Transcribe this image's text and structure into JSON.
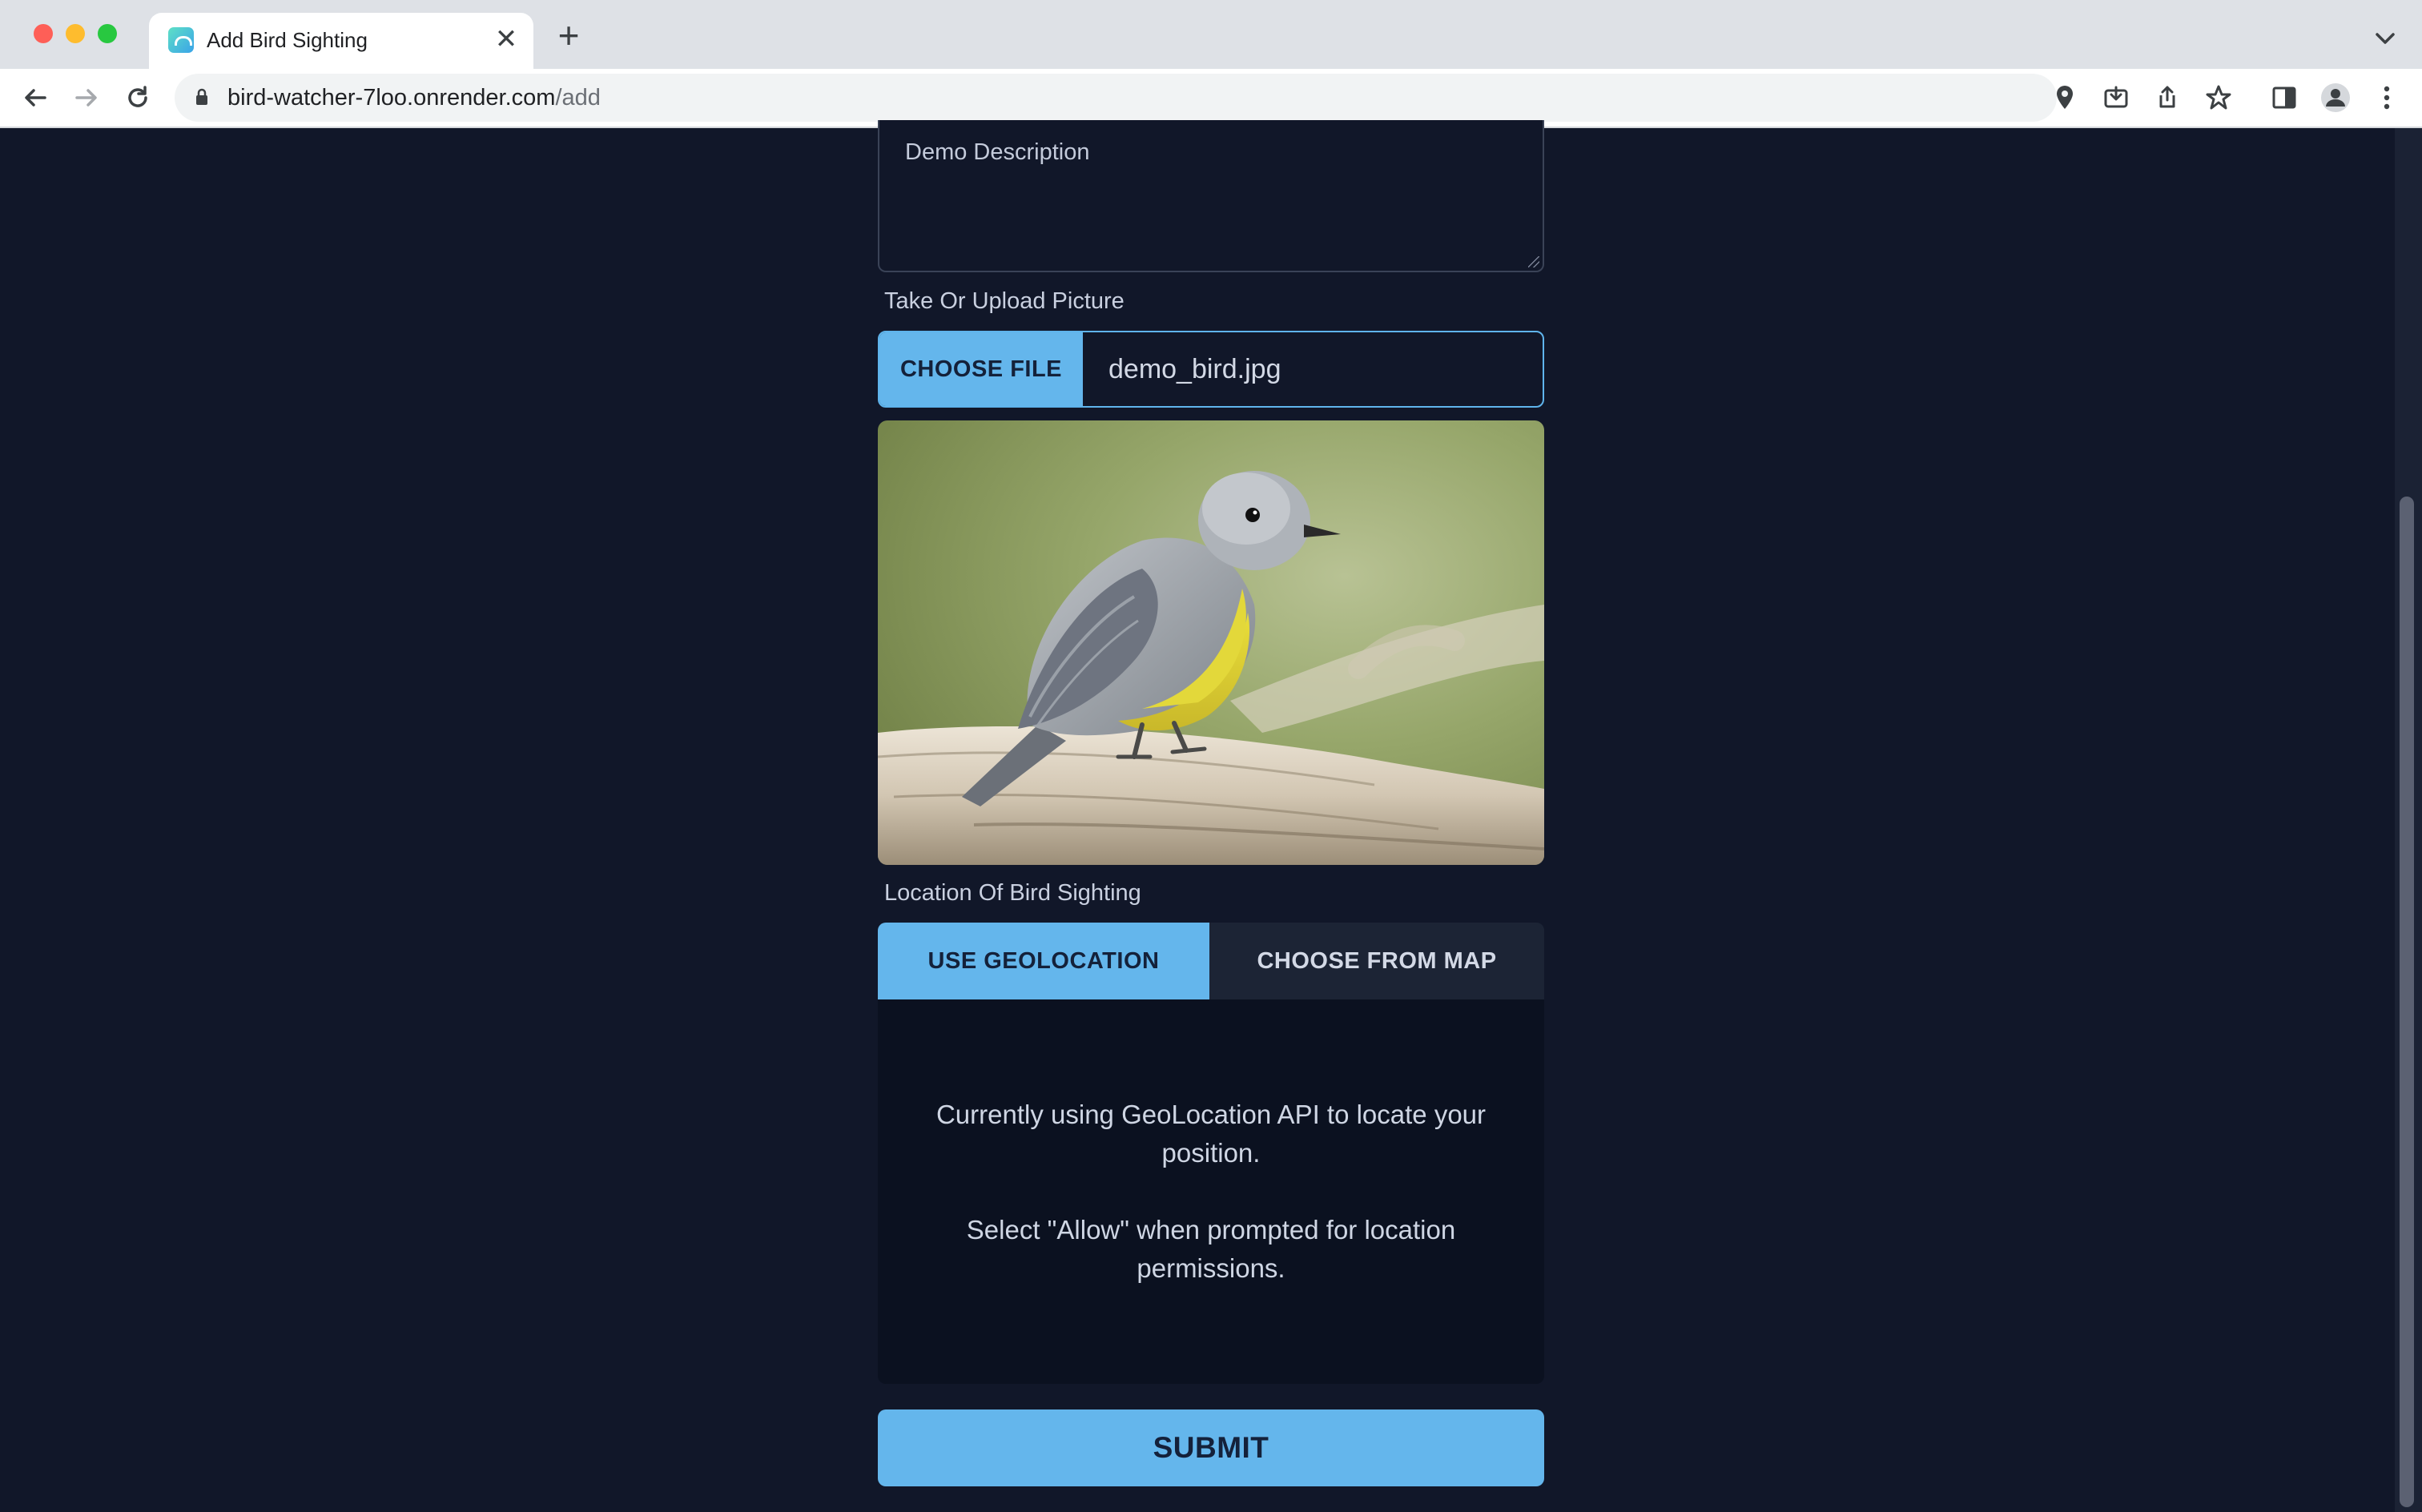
{
  "browser": {
    "tab_title": "Add Bird Sighting",
    "url_host": "bird-watcher-7loo.onrender.com",
    "url_path": "/add"
  },
  "form": {
    "description_value": "Demo Description",
    "picture_label": "Take Or Upload Picture",
    "choose_file_label": "CHOOSE FILE",
    "file_name": "demo_bird.jpg",
    "location_label": "Location Of Bird Sighting",
    "geolocation_button": "USE GEOLOCATION",
    "map_button": "CHOOSE FROM MAP",
    "geo_message_1": "Currently using GeoLocation API to locate your position.",
    "geo_message_2": "Select \"Allow\" when prompted for location permissions.",
    "submit_label": "SUBMIT"
  },
  "colors": {
    "page_background": "#111729",
    "accent": "#64b6ec",
    "panel": "#0b1120",
    "inactive_tab": "#1c2435"
  },
  "icons": [
    "close-icon",
    "plus-icon",
    "chevron-down-icon",
    "back-arrow-icon",
    "forward-arrow-icon",
    "reload-icon",
    "lock-icon",
    "location-pin-icon",
    "install-app-icon",
    "share-icon",
    "star-icon",
    "side-panel-icon",
    "profile-icon",
    "more-vert-icon"
  ]
}
